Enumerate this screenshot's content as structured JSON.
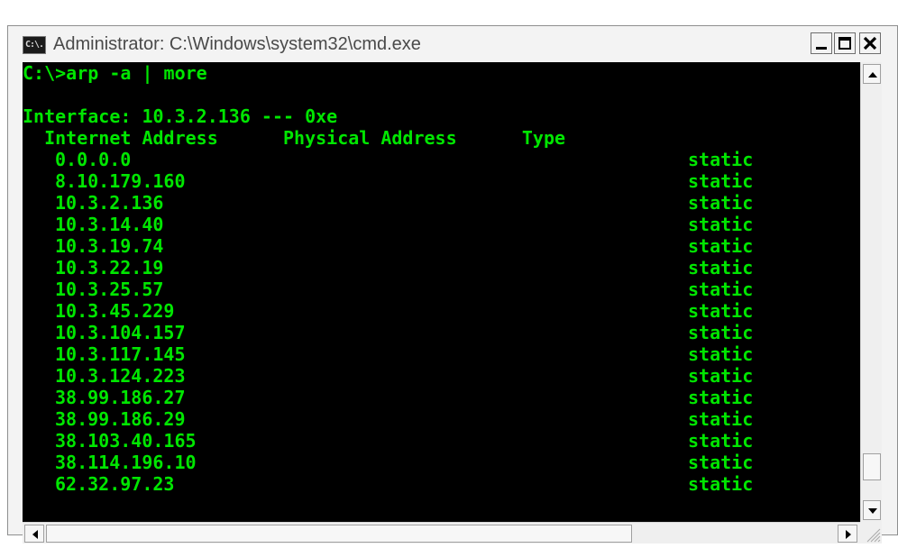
{
  "window": {
    "title": "Administrator: C:\\Windows\\system32\\cmd.exe",
    "app_icon_text": "C:\\."
  },
  "console": {
    "command_line": "C:\\>arp -a | more",
    "interface_line": "Interface: 10.3.2.136 --- 0xe",
    "header_line": "  Internet Address      Physical Address      Type",
    "entries": [
      {
        "address": "0.0.0.0",
        "physical": "",
        "type": "static"
      },
      {
        "address": "8.10.179.160",
        "physical": "",
        "type": "static"
      },
      {
        "address": "10.3.2.136",
        "physical": "",
        "type": "static"
      },
      {
        "address": "10.3.14.40",
        "physical": "",
        "type": "static"
      },
      {
        "address": "10.3.19.74",
        "physical": "",
        "type": "static"
      },
      {
        "address": "10.3.22.19",
        "physical": "",
        "type": "static"
      },
      {
        "address": "10.3.25.57",
        "physical": "",
        "type": "static"
      },
      {
        "address": "10.3.45.229",
        "physical": "",
        "type": "static"
      },
      {
        "address": "10.3.104.157",
        "physical": "",
        "type": "static"
      },
      {
        "address": "10.3.117.145",
        "physical": "",
        "type": "static"
      },
      {
        "address": "10.3.124.223",
        "physical": "",
        "type": "static"
      },
      {
        "address": "38.99.186.27",
        "physical": "",
        "type": "static"
      },
      {
        "address": "38.99.186.29",
        "physical": "",
        "type": "static"
      },
      {
        "address": "38.103.40.165",
        "physical": "",
        "type": "static"
      },
      {
        "address": "38.114.196.10",
        "physical": "",
        "type": "static"
      },
      {
        "address": "62.32.97.23",
        "physical": "",
        "type": "static"
      }
    ]
  },
  "icons": {
    "app": "cmd-console-icon",
    "minimize": "minimize-icon",
    "maximize": "maximize-icon",
    "close": "close-icon",
    "scroll_up": "arrow-up-icon",
    "scroll_down": "arrow-down-icon",
    "scroll_left": "arrow-left-icon",
    "scroll_right": "arrow-right-icon",
    "resize": "resize-grip-icon"
  },
  "colors": {
    "console_bg": "#000000",
    "console_text": "#00e600",
    "chrome": "#f3f3f3"
  }
}
